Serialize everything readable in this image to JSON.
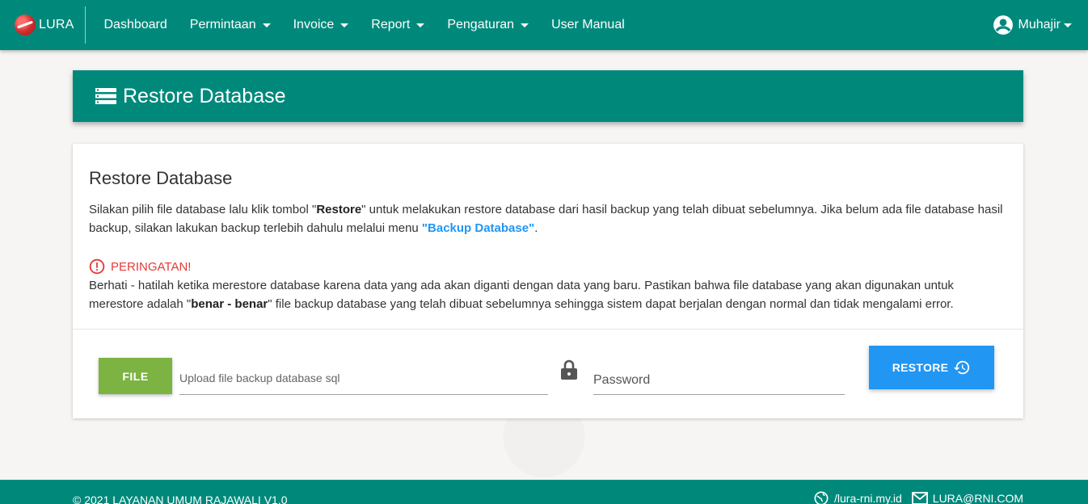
{
  "navbar": {
    "brand": "LURA",
    "items": [
      {
        "label": "Dashboard",
        "dropdown": false
      },
      {
        "label": "Permintaan",
        "dropdown": true
      },
      {
        "label": "Invoice",
        "dropdown": true
      },
      {
        "label": "Report",
        "dropdown": true
      },
      {
        "label": "Pengaturan",
        "dropdown": true
      },
      {
        "label": "User Manual",
        "dropdown": false
      }
    ],
    "user": "Muhajir"
  },
  "header": {
    "title": "Restore Database",
    "icon": "server-list-icon"
  },
  "card": {
    "title": "Restore Database",
    "intro_part1": "Silakan pilih file database lalu klik tombol \"",
    "intro_bold": "Restore",
    "intro_part2": "\" untuk melakukan restore database dari hasil backup yang telah dibuat sebelumnya. Jika belum ada file database hasil backup, silakan lakukan backup terlebih dahulu melalui menu ",
    "intro_link": "\"Backup Database\"",
    "intro_end": ".",
    "warning_title": "PERINGATAN!",
    "warning_part1": "Berhati - hatilah ketika merestore database karena data yang ada akan diganti dengan data yang baru. Pastikan bahwa file database yang akan digunakan untuk merestore adalah \"",
    "warning_bold": "benar - benar",
    "warning_part2": "\" file backup database yang telah dibuat sebelumnya sehingga sistem dapat berjalan dengan normal dan tidak mengalami error."
  },
  "form": {
    "file_button": "FILE",
    "file_placeholder": "Upload file backup database sql",
    "password_placeholder": "Password",
    "restore_button": "RESTORE"
  },
  "footer": {
    "copyright": "© 2021 LAYANAN UMUM RAJAWALI V1.0",
    "website": "/lura-rni.my.id",
    "email": "LURA@RNI.COM"
  },
  "colors": {
    "primary": "#00897b",
    "file_button": "#7cb342",
    "restore_button": "#2196f3",
    "warning": "#e53935",
    "link": "#2196f3"
  }
}
